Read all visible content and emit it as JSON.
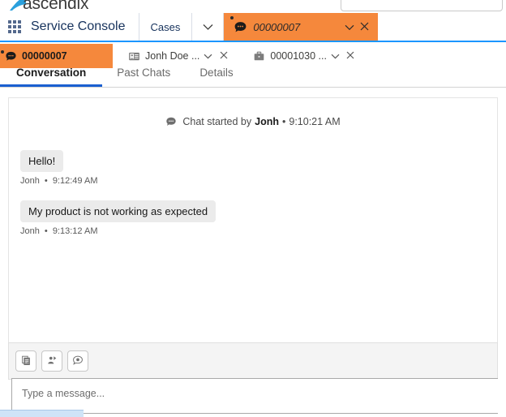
{
  "branding": {
    "logo_text": "ascendix",
    "logo_color": "#2aa0dd"
  },
  "search": {
    "placeholder": "",
    "icon": "search-icon"
  },
  "header": {
    "app_launcher_icon": "app-launcher-grid-icon",
    "app_name": "Service Console",
    "nav_item": "Cases",
    "nav_caret_icon": "chevron-down-icon",
    "workspace_tab": {
      "icon": "chat-bubble-icon",
      "label": "00000007",
      "caret_icon": "chevron-down-icon",
      "close_icon": "close-icon",
      "has_unread_dot": true,
      "active_color": "#f5883c"
    },
    "accent_underline_color": "#1b96ff"
  },
  "subtabs": [
    {
      "icon": "chat-bubble-icon",
      "label": "00000007",
      "active": true,
      "has_caret": false,
      "has_close": false,
      "has_unread_dot": true
    },
    {
      "icon": "contact-card-icon",
      "label": "Jonh Doe ...",
      "active": false,
      "has_caret": true,
      "has_close": true,
      "has_unread_dot": false
    },
    {
      "icon": "briefcase-icon",
      "label": "00001030 ...",
      "active": false,
      "has_caret": true,
      "has_close": true,
      "has_unread_dot": false
    }
  ],
  "navtabs": [
    {
      "label": "Conversation",
      "active": true
    },
    {
      "label": "Past Chats",
      "active": false
    },
    {
      "label": "Details",
      "active": false
    }
  ],
  "conversation": {
    "start_icon": "chat-bubble-icon",
    "start_prefix": "Chat started by",
    "start_author": "Jonh",
    "start_separator": "•",
    "start_time": "9:10:21 AM",
    "messages": [
      {
        "text": "Hello!",
        "author": "Jonh",
        "separator": "•",
        "time": "9:12:49 AM"
      },
      {
        "text": "My product is not working as expected",
        "author": "Jonh",
        "separator": "•",
        "time": "9:13:12 AM"
      }
    ]
  },
  "composer": {
    "buttons": [
      {
        "icon": "transcript-file-icon",
        "name": "chat-transcript-button"
      },
      {
        "icon": "transfer-person-icon",
        "name": "transfer-chat-button"
      },
      {
        "icon": "conversation-bubble-icon",
        "name": "quick-text-button"
      }
    ],
    "input_placeholder": "Type a message..."
  }
}
